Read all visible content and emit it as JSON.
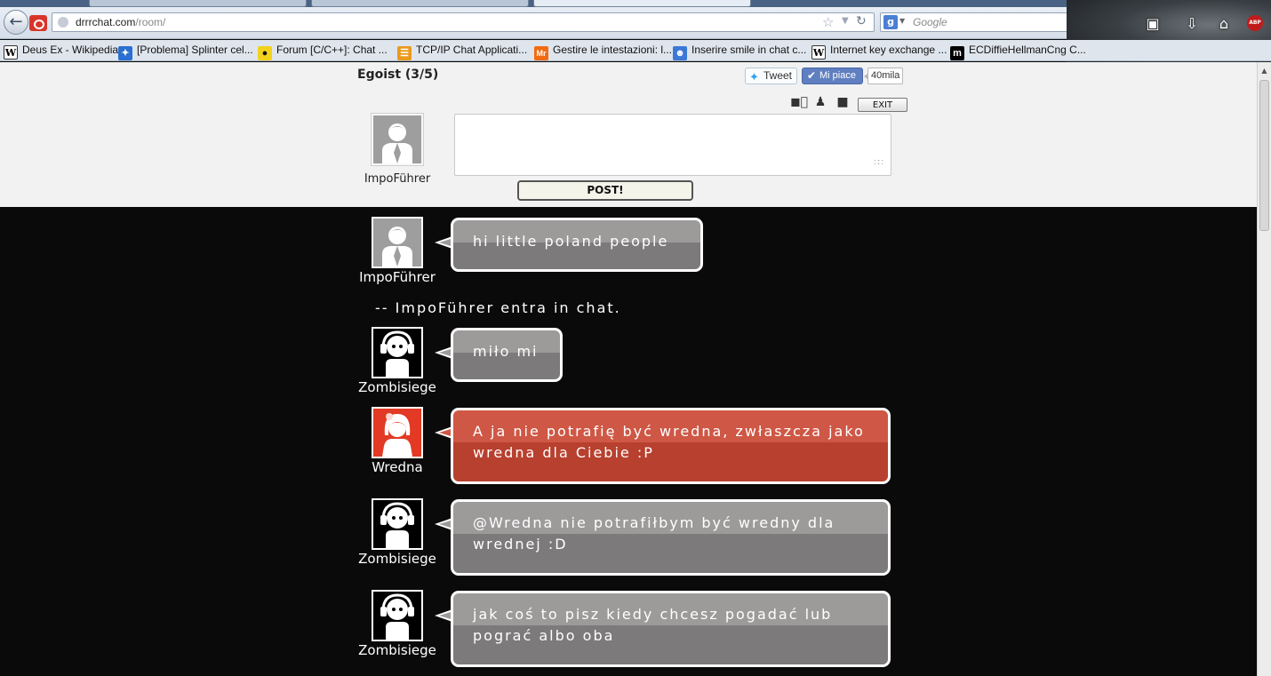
{
  "browser": {
    "url_host": "drrrchat.com",
    "url_path": "/room/",
    "search_placeholder": "Google",
    "search_engine_letter": "g",
    "abp_label": "ABP"
  },
  "bookmarks": [
    {
      "icon": "W",
      "label": "Deus Ex - Wikipedia"
    },
    {
      "icon": "",
      "label": "[Problema] Splinter cel..."
    },
    {
      "icon": "",
      "label": "Forum [C/C++]: Chat ..."
    },
    {
      "icon": "",
      "label": "TCP/IP Chat Applicati..."
    },
    {
      "icon": "Mr",
      "label": "Gestire le intestazioni: l..."
    },
    {
      "icon": "",
      "label": "Inserire smile in chat c..."
    },
    {
      "icon": "W",
      "label": "Internet key exchange ..."
    },
    {
      "icon": "m",
      "label": "ECDiffieHellmanCng C..."
    }
  ],
  "room": {
    "title": "Egoist (3/5)",
    "tweet_label": "Tweet",
    "like_label": "Mi piace",
    "like_count": "40mila",
    "exit_label": "EXIT",
    "post_label": "POST!",
    "self_name": "ImpoFührer",
    "message_value": ""
  },
  "chat": [
    {
      "type": "message",
      "user": "ImpoFührer",
      "avatar": "gray",
      "text": "hi little poland people"
    },
    {
      "type": "system",
      "text": "-- ImpoFührer entra in chat."
    },
    {
      "type": "message",
      "user": "Zombisiege",
      "avatar": "black",
      "text": "miło mi"
    },
    {
      "type": "message",
      "user": "Wredna",
      "avatar": "red",
      "text": "A ja nie potrafię być wredna, zwłaszcza jako wredna dla Ciebie :P"
    },
    {
      "type": "message",
      "user": "Zombisiege",
      "avatar": "black",
      "text": "@Wredna nie potrafiłbym być wredny dla wrednej :D"
    },
    {
      "type": "message",
      "user": "Zombisiege",
      "avatar": "black",
      "text": "jak coś to pisz kiedy chcesz pogadać lub pograć albo oba"
    }
  ],
  "colors": {
    "chat_background": "#0a0a0a",
    "bubble_gray": "#9d9a9a",
    "bubble_red": "#cf5745",
    "facebook_blue": "#5f7fc0",
    "twitter_blue": "#2aa3ef"
  }
}
